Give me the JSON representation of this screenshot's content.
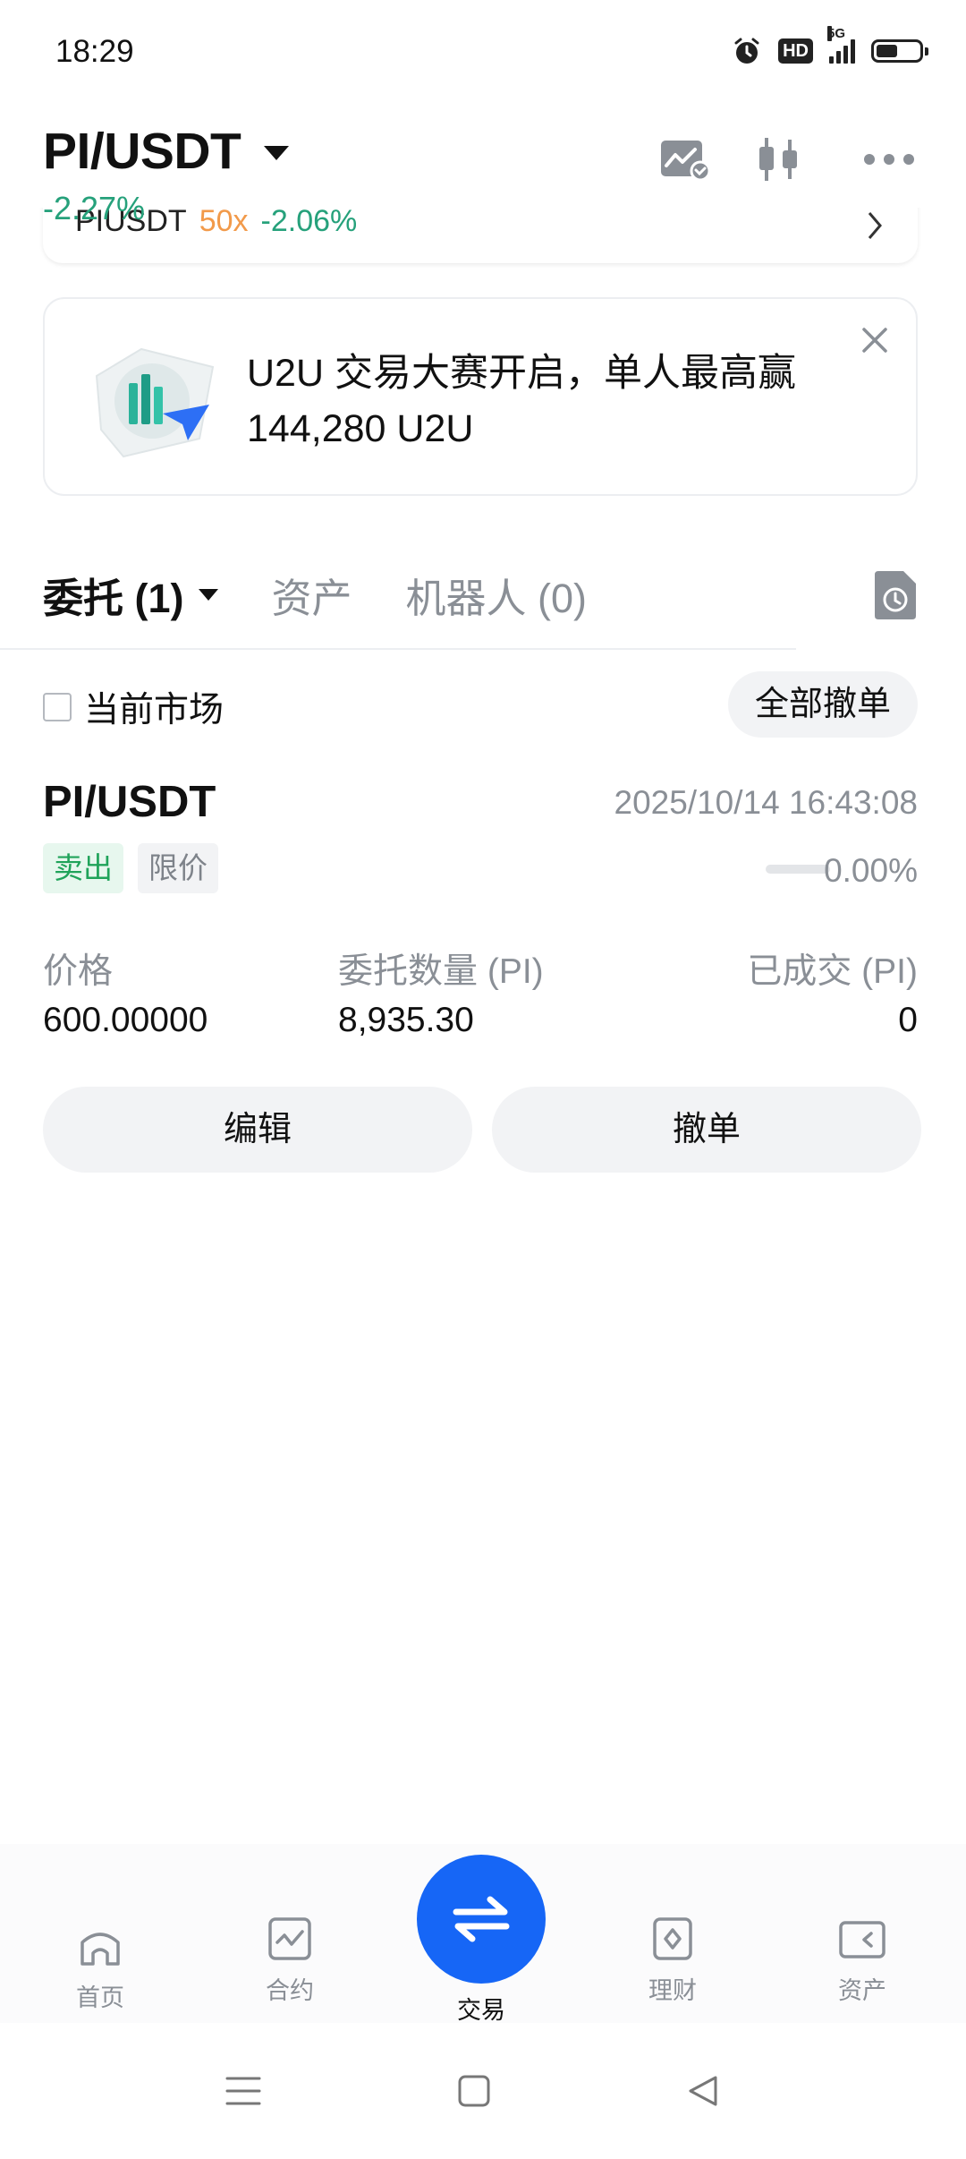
{
  "status_bar": {
    "time": "18:29",
    "hd": "HD",
    "network": "5G",
    "battery_level": 0.44
  },
  "header": {
    "pair": "PI/USDT",
    "change": "-2.27%"
  },
  "futures_strip": {
    "pair": "PIUSDT",
    "leverage": "50x",
    "change": "-2.06%"
  },
  "banner": {
    "text": "U2U 交易大赛开启，单人最高赢 144,280 U2U"
  },
  "tabs": [
    {
      "label": "委托 (1)"
    },
    {
      "label": "资产"
    },
    {
      "label": "机器人 (0)"
    }
  ],
  "filters": {
    "current_market": "当前市场",
    "cancel_all": "全部撤单"
  },
  "order": {
    "pair": "PI/USDT",
    "time": "2025/10/14 16:43:08",
    "side": "卖出",
    "type": "限价",
    "filled_pct": "0.00%",
    "filled_fraction": 0.0,
    "columns": {
      "price_label": "价格",
      "price": "600.00000",
      "qty_label": "委托数量 (PI)",
      "qty": "8,935.30",
      "filled_label": "已成交 (PI)",
      "filled": "0"
    },
    "edit": "编辑",
    "cancel": "撤单"
  },
  "bottom_nav": [
    {
      "label": "首页",
      "icon": "home-icon"
    },
    {
      "label": "合约",
      "icon": "futures-chart-icon"
    },
    {
      "label": "交易",
      "icon": "swap-arrows-icon"
    },
    {
      "label": "理财",
      "icon": "earn-icon"
    },
    {
      "label": "资产",
      "icon": "wallet-icon"
    }
  ],
  "colors": {
    "accent": "#1666f6",
    "up_green": "#26a17b",
    "sell_green": "#20a35a",
    "leverage_orange": "#f29a4a"
  }
}
